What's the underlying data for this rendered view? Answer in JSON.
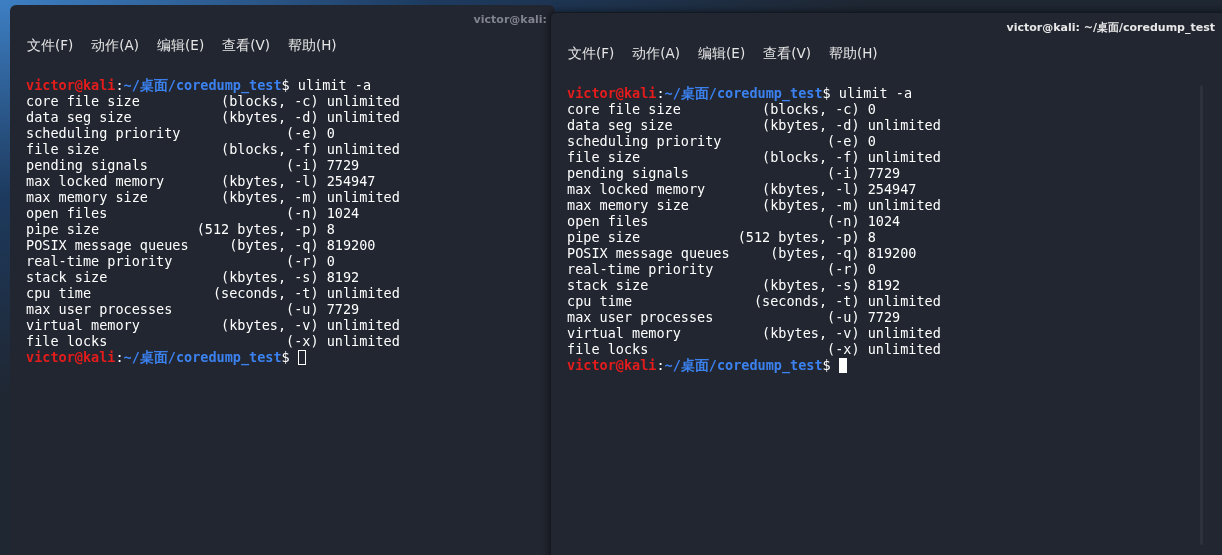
{
  "windows": [
    {
      "title": "victor@kali:",
      "focused": false,
      "menu": [
        "文件(F)",
        "动作(A)",
        "编辑(E)",
        "查看(V)",
        "帮助(H)"
      ],
      "prompt": {
        "user": "victor@kali",
        "colon": ":",
        "path": "~/桌面/coredump_test",
        "symbol": "$",
        "command": " ulimit -a"
      },
      "output": [
        "core file size          (blocks, -c) unlimited",
        "data seg size           (kbytes, -d) unlimited",
        "scheduling priority             (-e) 0",
        "file size               (blocks, -f) unlimited",
        "pending signals                 (-i) 7729",
        "max locked memory       (kbytes, -l) 254947",
        "max memory size         (kbytes, -m) unlimited",
        "open files                      (-n) 1024",
        "pipe size            (512 bytes, -p) 8",
        "POSIX message queues     (bytes, -q) 819200",
        "real-time priority              (-r) 0",
        "stack size              (kbytes, -s) 8192",
        "cpu time               (seconds, -t) unlimited",
        "max user processes              (-u) 7729",
        "virtual memory          (kbytes, -v) unlimited",
        "file locks                      (-x) unlimited"
      ],
      "last_prompt": {
        "user": "victor@kali",
        "colon": ":",
        "path": "~/桌面/coredump_test",
        "symbol": "$"
      }
    },
    {
      "title": "victor@kali: ~/桌面/coredump_test",
      "focused": true,
      "menu": [
        "文件(F)",
        "动作(A)",
        "编辑(E)",
        "查看(V)",
        "帮助(H)"
      ],
      "prompt": {
        "user": "victor@kali",
        "colon": ":",
        "path": "~/桌面/coredump_test",
        "symbol": "$",
        "command": " ulimit -a"
      },
      "output": [
        "core file size          (blocks, -c) 0",
        "data seg size           (kbytes, -d) unlimited",
        "scheduling priority             (-e) 0",
        "file size               (blocks, -f) unlimited",
        "pending signals                 (-i) 7729",
        "max locked memory       (kbytes, -l) 254947",
        "max memory size         (kbytes, -m) unlimited",
        "open files                      (-n) 1024",
        "pipe size            (512 bytes, -p) 8",
        "POSIX message queues     (bytes, -q) 819200",
        "real-time priority              (-r) 0",
        "stack size              (kbytes, -s) 8192",
        "cpu time               (seconds, -t) unlimited",
        "max user processes              (-u) 7729",
        "virtual memory          (kbytes, -v) unlimited",
        "file locks                      (-x) unlimited"
      ],
      "last_prompt": {
        "user": "victor@kali",
        "colon": ":",
        "path": "~/桌面/coredump_test",
        "symbol": "$"
      }
    }
  ]
}
